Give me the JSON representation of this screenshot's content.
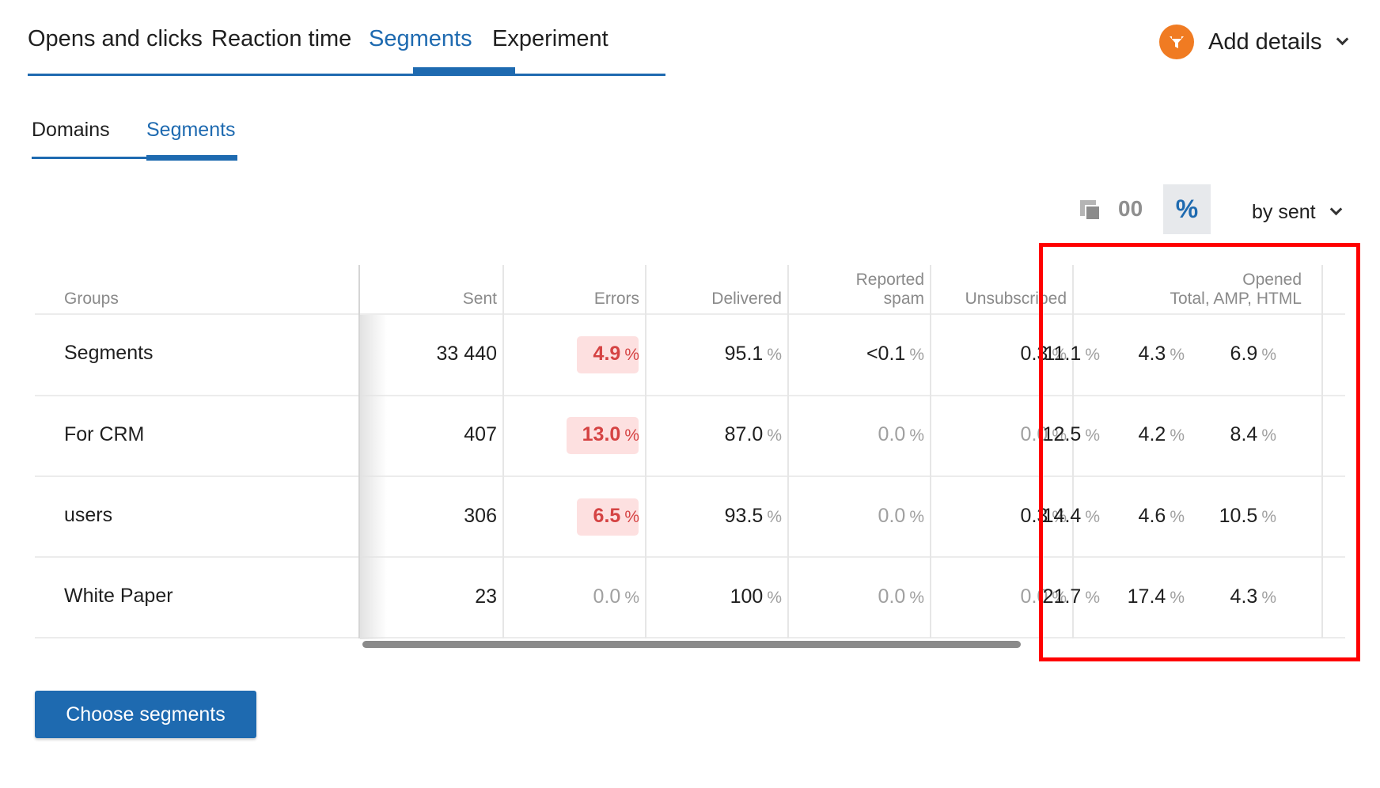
{
  "main_tabs": [
    {
      "label": "Opens and clicks"
    },
    {
      "label": "Reaction time"
    },
    {
      "label": "Segments"
    },
    {
      "label": "Experiment"
    }
  ],
  "active_main_tab": "Segments",
  "add_details": {
    "label": "Add details",
    "icon": "filter-icon",
    "color": "#f07b22"
  },
  "sub_tabs": [
    {
      "label": "Domains"
    },
    {
      "label": "Segments"
    }
  ],
  "active_sub_tab": "Segments",
  "toolbar": {
    "copy_icon": "copy-icon",
    "absolute_label": "00",
    "percent_label": "%",
    "sort_label": "by sent",
    "active_mode": "%"
  },
  "table": {
    "headers": {
      "groups": "Groups",
      "sent": "Sent",
      "errors": "Errors",
      "delivered": "Delivered",
      "reported_spam_l1": "Reported",
      "reported_spam_l2": "spam",
      "unsubscribed": "Unsubscribed",
      "opened_l1": "Opened",
      "opened_l2": "Total, AMP, HTML"
    },
    "unit": "%",
    "rows": [
      {
        "group": "Segments",
        "sent": "33 440",
        "errors": "4.9",
        "delivered": "95.1",
        "spam": "<0.1",
        "unsub": "0.3",
        "opened_total": "11.1",
        "opened_amp": "4.3",
        "opened_html": "6.9"
      },
      {
        "group": "For CRM",
        "sent": "407",
        "errors": "13.0",
        "delivered": "87.0",
        "spam": "0.0",
        "unsub": "0.0",
        "opened_total": "12.5",
        "opened_amp": "4.2",
        "opened_html": "8.4"
      },
      {
        "group": "users",
        "sent": "306",
        "errors": "6.5",
        "delivered": "93.5",
        "spam": "0.0",
        "unsub": "0.3",
        "opened_total": "14.4",
        "opened_amp": "4.6",
        "opened_html": "10.5"
      },
      {
        "group": "White Paper",
        "sent": "23",
        "errors": "0.0",
        "delivered": "100",
        "spam": "0.0",
        "unsub": "0.0",
        "opened_total": "21.7",
        "opened_amp": "17.4",
        "opened_html": "4.3"
      }
    ]
  },
  "choose_segments_label": "Choose segments",
  "colors": {
    "accent": "#1e6ab0",
    "error": "#d54343",
    "error_bg": "#fde0e0",
    "highlight": "#ff0000"
  }
}
